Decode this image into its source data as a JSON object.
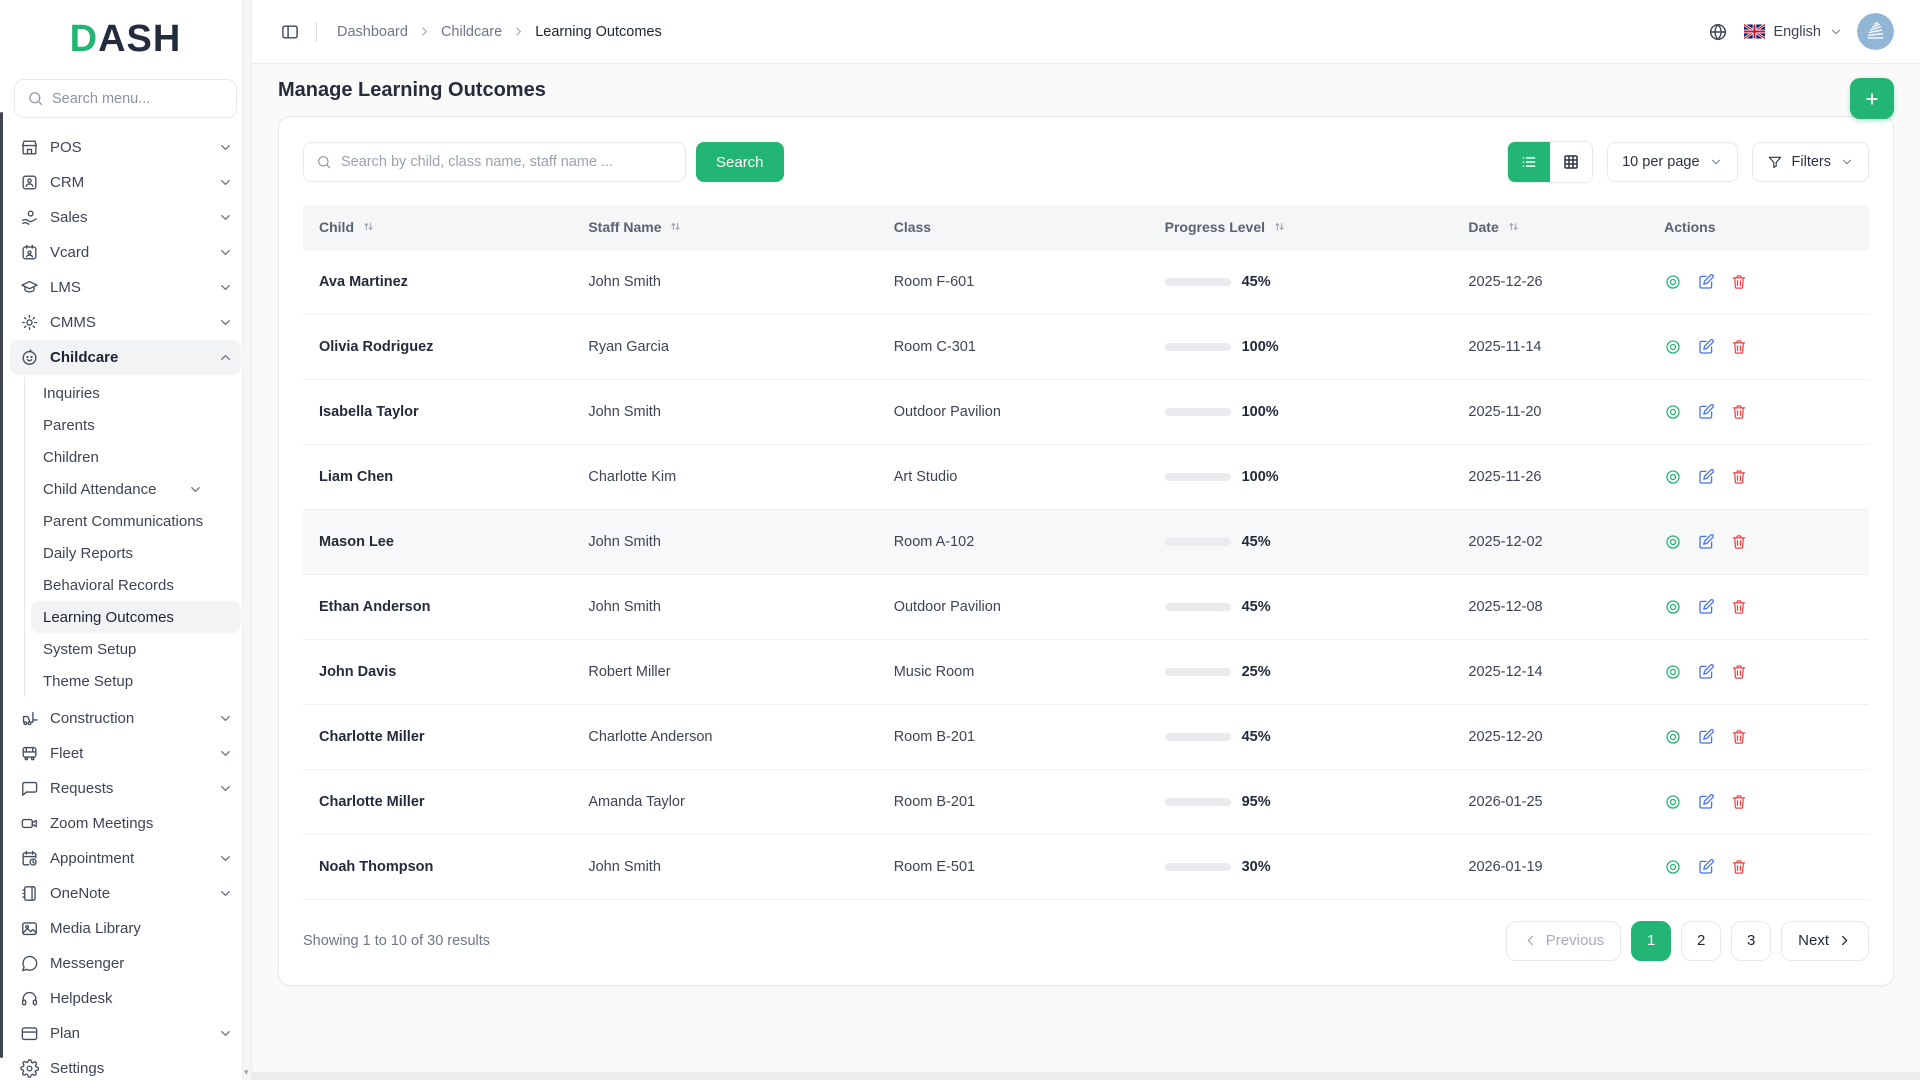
{
  "brand": {
    "logo_d": "D",
    "logo_rest": "ASH"
  },
  "colors": {
    "accent": "#22b573",
    "edit_icon": "#4672e8",
    "delete_icon": "#ef4444"
  },
  "sidebar": {
    "search_placeholder": "Search menu...",
    "items": [
      {
        "label": "POS",
        "icon": "store",
        "chevron": "down"
      },
      {
        "label": "CRM",
        "icon": "crm",
        "chevron": "down"
      },
      {
        "label": "Sales",
        "icon": "sales",
        "chevron": "down"
      },
      {
        "label": "Vcard",
        "icon": "vcard",
        "chevron": "down"
      },
      {
        "label": "LMS",
        "icon": "graduation-cap",
        "chevron": "down"
      },
      {
        "label": "CMMS",
        "icon": "cog",
        "chevron": "down"
      },
      {
        "label": "Childcare",
        "icon": "baby",
        "chevron": "up",
        "active": true,
        "children": [
          {
            "label": "Inquiries"
          },
          {
            "label": "Parents"
          },
          {
            "label": "Children"
          },
          {
            "label": "Child Attendance",
            "chevron": "down"
          },
          {
            "label": "Parent Communications"
          },
          {
            "label": "Daily Reports"
          },
          {
            "label": "Behavioral Records"
          },
          {
            "label": "Learning Outcomes",
            "active": true
          },
          {
            "label": "System Setup"
          },
          {
            "label": "Theme Setup"
          }
        ]
      },
      {
        "label": "Construction",
        "icon": "forklift",
        "chevron": "down"
      },
      {
        "label": "Fleet",
        "icon": "bus",
        "chevron": "down"
      },
      {
        "label": "Requests",
        "icon": "message-square",
        "chevron": "down"
      },
      {
        "label": "Zoom Meetings",
        "icon": "video"
      },
      {
        "label": "Appointment",
        "icon": "calendar-clock",
        "chevron": "down"
      },
      {
        "label": "OneNote",
        "icon": "notebook",
        "chevron": "down"
      },
      {
        "label": "Media Library",
        "icon": "image"
      },
      {
        "label": "Messenger",
        "icon": "message-circle"
      },
      {
        "label": "Helpdesk",
        "icon": "headphones"
      },
      {
        "label": "Plan",
        "icon": "credit-card",
        "chevron": "down"
      },
      {
        "label": "Settings",
        "icon": "gear"
      }
    ]
  },
  "topbar": {
    "breadcrumb": [
      "Dashboard",
      "Childcare",
      "Learning Outcomes"
    ],
    "language_label": "English"
  },
  "page": {
    "title": "Manage Learning Outcomes"
  },
  "toolbar": {
    "search_placeholder": "Search by child, class name, staff name ...",
    "search_button": "Search",
    "per_page": "10 per page",
    "filters_label": "Filters"
  },
  "table": {
    "columns": [
      {
        "label": "Child",
        "sortable": true
      },
      {
        "label": "Staff Name",
        "sortable": true
      },
      {
        "label": "Class",
        "sortable": false
      },
      {
        "label": "Progress Level",
        "sortable": true
      },
      {
        "label": "Date",
        "sortable": true
      },
      {
        "label": "Actions",
        "sortable": false
      }
    ],
    "rows": [
      {
        "child": "Ava Martinez",
        "staff": "John Smith",
        "class": "Room F-601",
        "progress": 45,
        "progress_label": "45%",
        "date": "2025-12-26"
      },
      {
        "child": "Olivia Rodriguez",
        "staff": "Ryan Garcia",
        "class": "Room C-301",
        "progress": 100,
        "progress_label": "100%",
        "date": "2025-11-14"
      },
      {
        "child": "Isabella Taylor",
        "staff": "John Smith",
        "class": "Outdoor Pavilion",
        "progress": 100,
        "progress_label": "100%",
        "date": "2025-11-20"
      },
      {
        "child": "Liam Chen",
        "staff": "Charlotte Kim",
        "class": "Art Studio",
        "progress": 100,
        "progress_label": "100%",
        "date": "2025-11-26"
      },
      {
        "child": "Mason Lee",
        "staff": "John Smith",
        "class": "Room A-102",
        "progress": 45,
        "progress_label": "45%",
        "date": "2025-12-02",
        "highlight": true
      },
      {
        "child": "Ethan Anderson",
        "staff": "John Smith",
        "class": "Outdoor Pavilion",
        "progress": 45,
        "progress_label": "45%",
        "date": "2025-12-08"
      },
      {
        "child": "John Davis",
        "staff": "Robert Miller",
        "class": "Music Room",
        "progress": 25,
        "progress_label": "25%",
        "date": "2025-12-14"
      },
      {
        "child": "Charlotte Miller",
        "staff": "Charlotte Anderson",
        "class": "Room B-201",
        "progress": 45,
        "progress_label": "45%",
        "date": "2025-12-20"
      },
      {
        "child": "Charlotte Miller",
        "staff": "Amanda Taylor",
        "class": "Room B-201",
        "progress": 95,
        "progress_label": "95%",
        "date": "2026-01-25"
      },
      {
        "child": "Noah Thompson",
        "staff": "John Smith",
        "class": "Room E-501",
        "progress": 30,
        "progress_label": "30%",
        "date": "2026-01-19"
      }
    ]
  },
  "footer": {
    "summary": "Showing 1 to 10 of 30 results",
    "previous_label": "Previous",
    "next_label": "Next",
    "pages": [
      "1",
      "2",
      "3"
    ],
    "active_page": "1"
  }
}
